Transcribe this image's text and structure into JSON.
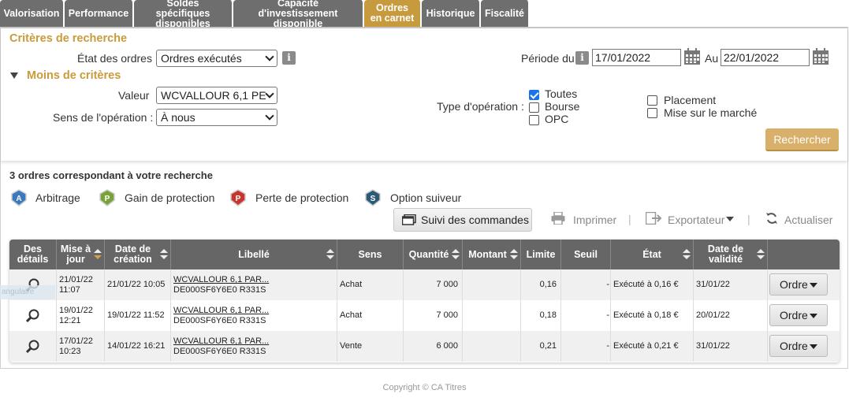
{
  "tabs": [
    {
      "label": "Valorisation",
      "active": false
    },
    {
      "label": "Performance",
      "active": false
    },
    {
      "label": "Soldes spécifiques disponibles",
      "active": false
    },
    {
      "label": "Capacité d'investissement disponible",
      "active": false
    },
    {
      "label": "Ordres en carnet",
      "active": true
    },
    {
      "label": "Historique",
      "active": false
    },
    {
      "label": "Fiscalité",
      "active": false
    }
  ],
  "search": {
    "title": "Critères de recherche",
    "etat_label": "État des ordres",
    "etat_value": "Ordres exécutés",
    "periode_label": "Période du",
    "date_from": "17/01/2022",
    "au_label": "Au",
    "date_to": "22/01/2022",
    "less_criteria": "Moins de critères",
    "valeur_label": "Valeur",
    "valeur_value": "WCVALLOUR 6,1 PE",
    "sens_label": "Sens de l'opération :",
    "sens_value": "À nous",
    "type_label": "Type d'opération :",
    "types": [
      {
        "label": "Toutes",
        "checked": true
      },
      {
        "label": "Bourse",
        "checked": false
      },
      {
        "label": "OPC",
        "checked": false
      },
      {
        "label": "Placement",
        "checked": false
      },
      {
        "label": "Mise sur le marché",
        "checked": false
      }
    ],
    "search_button": "Rechercher",
    "info_glyph": "i"
  },
  "results": {
    "count_text": "3 ordres correspondant à votre recherche",
    "legend": [
      {
        "letter": "A",
        "label": "Arbitrage",
        "color": "#3a78c0"
      },
      {
        "letter": "P",
        "label": "Gain de protection",
        "color": "#7aa23a"
      },
      {
        "letter": "P",
        "label": "Perte de protection",
        "color": "#c8352e"
      },
      {
        "letter": "S",
        "label": "Option suiveur",
        "color": "#2b5a78"
      }
    ],
    "toolbar": {
      "suivi": "Suivi des commandes",
      "imprimer": "Imprimer",
      "exportateur": "Exportateur",
      "actualiser": "Actualiser"
    }
  },
  "table": {
    "headers": [
      "Des détails",
      "Mise à jour",
      "Date de création",
      "Libellé",
      "Sens",
      "Quantité",
      "Montant",
      "Limite",
      "Seuil",
      "État",
      "Date de validité",
      ""
    ],
    "rows": [
      {
        "maj": "21/01/22 11:07",
        "creation": "21/01/22 10:05",
        "libelle1": "WCVALLOUR 6,1 PAR...",
        "libelle2": "DE000SF6Y6E0 R331S",
        "sens": "Achat",
        "quantite": "7 000",
        "montant": "",
        "limite": "0,16",
        "seuil": "-",
        "etat": "Exécuté à 0,16 €",
        "validite": "31/01/22",
        "action": "Ordre"
      },
      {
        "maj": "19/01/22 12:21",
        "creation": "19/01/22 11:52",
        "libelle1": "WCVALLOUR 6,1 PAR...",
        "libelle2": "DE000SF6Y6E0 R331S",
        "sens": "Achat",
        "quantite": "7 000",
        "montant": "",
        "limite": "0,18",
        "seuil": "-",
        "etat": "Exécuté à 0,18 €",
        "validite": "20/01/22",
        "action": "Ordre"
      },
      {
        "maj": "17/01/22 10:23",
        "creation": "14/01/22 16:21",
        "libelle1": "WCVALLOUR 6,1 PAR...",
        "libelle2": "DE000SF6Y6E0 R331S",
        "sens": "Vente",
        "quantite": "6 000",
        "montant": "",
        "limite": "0,21",
        "seuil": "-",
        "etat": "Exécuté à 0,21 €",
        "validite": "31/01/22",
        "action": "Ordre"
      }
    ],
    "tooltip_fragment": "angulaire"
  },
  "footer": {
    "copyright": "Copyright © CA Titres"
  }
}
